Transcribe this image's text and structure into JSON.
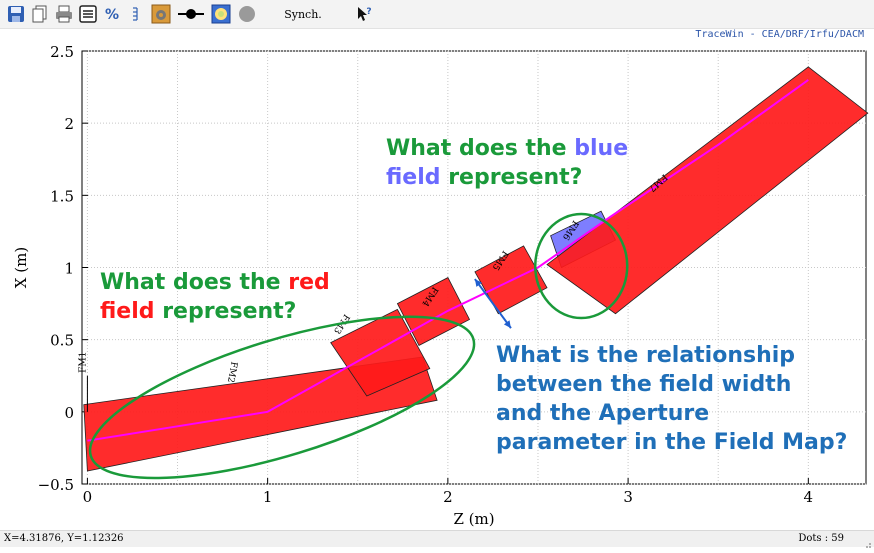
{
  "toolbar": {
    "synch_label": "Synch.",
    "icons": [
      "save-icon",
      "copy-icon",
      "print-icon",
      "list-icon",
      "percent-icon",
      "chart-icon",
      "settings-icon",
      "dot-line-icon",
      "target-icon",
      "circle-icon",
      "help-cursor-icon"
    ]
  },
  "credit": "TraceWin - CEA/DRF/Irfu/DACM",
  "status": {
    "cursor": "X=4.31876,  Y=1.12326",
    "dots": "Dots : 59"
  },
  "colors": {
    "field_red": "#ff1a1a",
    "field_blue": "#7070ff",
    "beam_line": "#ff00ff",
    "ellipse_green": "#1a9a3a",
    "note_green": "#1a9a3a",
    "note_red": "#ff1a1a",
    "note_blue_word": "#6a6aff",
    "note_dark_blue": "#1f6fb8",
    "arrow_blue": "#1f5fd0"
  },
  "chart_data": {
    "type": "diagram-plot",
    "xlabel": "Z (m)",
    "ylabel": "X (m)",
    "xlim": [
      -0.03,
      4.32
    ],
    "ylim": [
      -0.5,
      2.5
    ],
    "xticks": [
      {
        "v": 0,
        "label": "0"
      },
      {
        "v": 1,
        "label": "1"
      },
      {
        "v": 2,
        "label": "2"
      },
      {
        "v": 3,
        "label": "3"
      },
      {
        "v": 4,
        "label": "4"
      }
    ],
    "yticks": [
      {
        "v": -0.5,
        "label": "−0.5"
      },
      {
        "v": 0,
        "label": "0"
      },
      {
        "v": 0.5,
        "label": "0.5"
      },
      {
        "v": 1,
        "label": "1"
      },
      {
        "v": 1.5,
        "label": "1.5"
      },
      {
        "v": 2,
        "label": "2"
      },
      {
        "v": 2.5,
        "label": "2.5"
      }
    ],
    "grid": true,
    "field_maps": [
      {
        "name": "FM2",
        "color": "red",
        "corners": [
          [
            -0.02,
            0.05
          ],
          [
            1.86,
            0.38
          ],
          [
            1.94,
            0.08
          ],
          [
            0.0,
            -0.41
          ]
        ],
        "label_at": [
          0.8,
          0.35
        ],
        "angle": -10
      },
      {
        "name": "FM3",
        "color": "red",
        "corners": [
          [
            1.35,
            0.48
          ],
          [
            1.72,
            0.71
          ],
          [
            1.9,
            0.3
          ],
          [
            1.55,
            0.11
          ]
        ],
        "label_at": [
          1.43,
          0.68
        ],
        "angle": -33
      },
      {
        "name": "FM4",
        "color": "red",
        "corners": [
          [
            1.72,
            0.75
          ],
          [
            2.0,
            0.93
          ],
          [
            2.12,
            0.64
          ],
          [
            1.84,
            0.46
          ]
        ],
        "label_at": [
          1.92,
          0.87
        ],
        "angle": -33
      },
      {
        "name": "FM5",
        "color": "red",
        "corners": [
          [
            2.15,
            0.97
          ],
          [
            2.42,
            1.15
          ],
          [
            2.55,
            0.86
          ],
          [
            2.28,
            0.68
          ]
        ],
        "label_at": [
          2.31,
          1.12
        ],
        "angle": -33
      },
      {
        "name": "FM6",
        "color": "blue",
        "corners": [
          [
            2.57,
            1.22
          ],
          [
            2.85,
            1.39
          ],
          [
            2.93,
            1.19
          ],
          [
            2.63,
            1.0
          ]
        ],
        "label_at": [
          2.7,
          1.33
        ],
        "angle": -33
      },
      {
        "name": "FM7",
        "color": "red",
        "corners": [
          [
            2.55,
            1.02
          ],
          [
            4.0,
            2.39
          ],
          [
            4.33,
            2.07
          ],
          [
            2.93,
            0.68
          ]
        ],
        "label_at": [
          3.2,
          1.65
        ],
        "angle": -48
      }
    ],
    "fm1_label": "FM1",
    "beam_path": [
      [
        0.0,
        -0.2
      ],
      [
        0.5,
        -0.1
      ],
      [
        1.0,
        0.0
      ],
      [
        1.5,
        0.35
      ],
      [
        2.0,
        0.7
      ],
      [
        2.5,
        1.0
      ],
      [
        2.9,
        1.35
      ],
      [
        3.5,
        1.85
      ],
      [
        4.0,
        2.3
      ]
    ],
    "annotations": {
      "red_question": {
        "line1_a": "What does the ",
        "line1_b": "red",
        "line2_a": "field",
        "line2_b": " represent?"
      },
      "blue_question": {
        "line1_a": "What does the ",
        "line1_b": "blue",
        "line2_a": "field",
        "line2_b": " represent?"
      },
      "relationship_question": [
        "What is the relationship",
        "between the field width",
        "and the Aperture",
        "parameter in the Field Map?"
      ]
    }
  }
}
